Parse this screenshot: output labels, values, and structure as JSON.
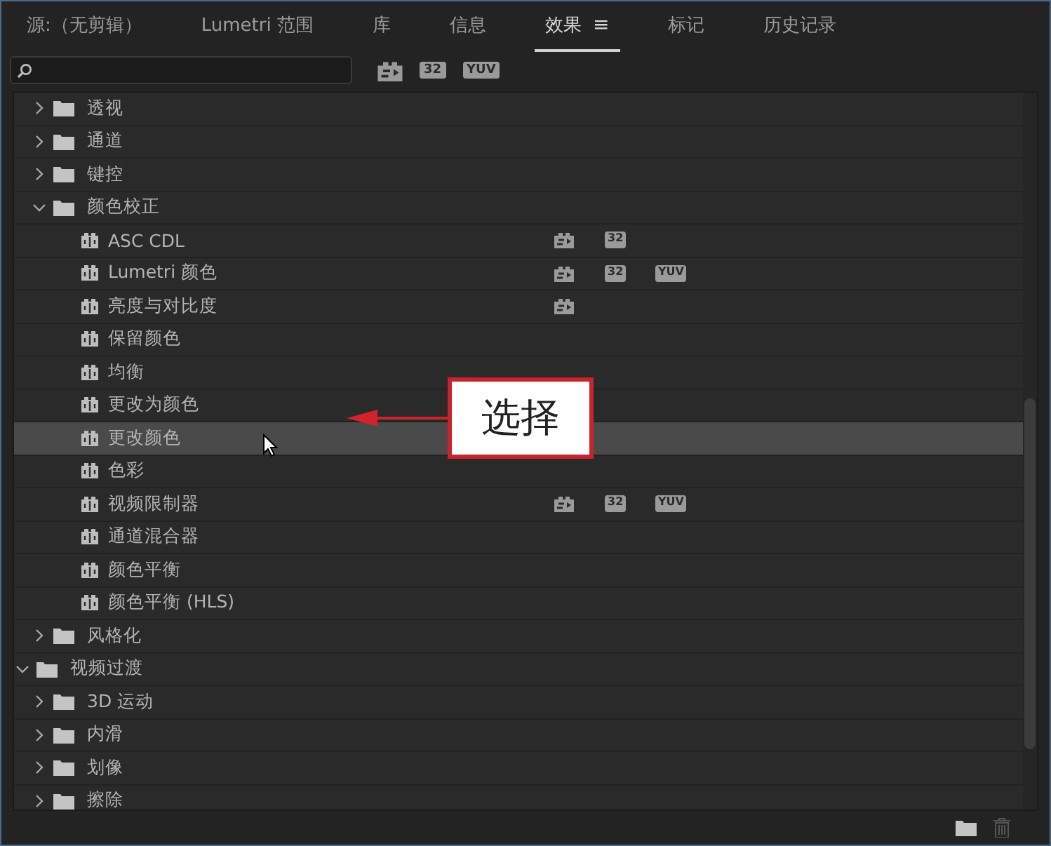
{
  "tabs": [
    {
      "label": "源:（无剪辑）",
      "selected": false
    },
    {
      "label": "Lumetri 范围",
      "selected": false
    },
    {
      "label": "库",
      "selected": false
    },
    {
      "label": "信息",
      "selected": false
    },
    {
      "label": "效果",
      "selected": true,
      "menu": "≡"
    },
    {
      "label": "标记",
      "selected": false
    },
    {
      "label": "历史记录",
      "selected": false
    }
  ],
  "toolbar": {
    "filters": [
      {
        "kind": "accelerated"
      },
      {
        "kind": "bit_depth",
        "label": "32"
      },
      {
        "kind": "yuv",
        "label": "YUV"
      }
    ]
  },
  "tree": [
    {
      "children": [
        {
          "kind": "folder",
          "label": "透视",
          "expanded": false,
          "selected": false
        },
        {
          "kind": "folder",
          "label": "通道",
          "expanded": false,
          "selected": false
        },
        {
          "kind": "folder",
          "label": "键控",
          "expanded": false,
          "selected": false
        },
        {
          "kind": "folder",
          "label": "颜色校正",
          "expanded": true,
          "selected": false,
          "children": [
            {
              "kind": "effect",
              "label": "ASC CDL",
              "selected": false,
              "badges": [
                {
                  "kind": "accelerated"
                },
                {
                  "kind": "bit_depth",
                  "label": "32"
                }
              ]
            },
            {
              "kind": "effect",
              "label": "Lumetri 颜色",
              "selected": false,
              "badges": [
                {
                  "kind": "accelerated"
                },
                {
                  "kind": "bit_depth",
                  "label": "32"
                },
                {
                  "kind": "yuv",
                  "label": "YUV"
                }
              ]
            },
            {
              "kind": "effect",
              "label": "亮度与对比度",
              "selected": false,
              "badges": [
                {
                  "kind": "accelerated"
                }
              ]
            },
            {
              "kind": "effect",
              "label": "保留颜色",
              "selected": false
            },
            {
              "kind": "effect",
              "label": "均衡",
              "selected": false
            },
            {
              "kind": "effect",
              "label": "更改为颜色",
              "selected": false
            },
            {
              "kind": "effect",
              "label": "更改颜色",
              "selected": true
            },
            {
              "kind": "effect",
              "label": "色彩",
              "selected": false
            },
            {
              "kind": "effect",
              "label": "视频限制器",
              "selected": false,
              "badges": [
                {
                  "kind": "accelerated"
                },
                {
                  "kind": "bit_depth",
                  "label": "32"
                },
                {
                  "kind": "yuv",
                  "label": "YUV"
                }
              ]
            },
            {
              "kind": "effect",
              "label": "通道混合器",
              "selected": false
            },
            {
              "kind": "effect",
              "label": "颜色平衡",
              "selected": false
            },
            {
              "kind": "effect",
              "label": "颜色平衡 (HLS)",
              "selected": false
            }
          ]
        },
        {
          "kind": "folder",
          "label": "风格化",
          "expanded": false,
          "selected": false
        }
      ]
    },
    {
      "kind": "folder",
      "label": "视频过渡",
      "expanded": true,
      "selected": false,
      "children": [
        {
          "kind": "folder",
          "label": "3D 运动",
          "expanded": false,
          "selected": false
        },
        {
          "kind": "folder",
          "label": "内滑",
          "expanded": false,
          "selected": false
        },
        {
          "kind": "folder",
          "label": "划像",
          "expanded": false,
          "selected": false
        },
        {
          "kind": "folder",
          "label": "擦除",
          "expanded": false,
          "selected": false
        }
      ]
    }
  ],
  "callout": {
    "label": "选择"
  }
}
